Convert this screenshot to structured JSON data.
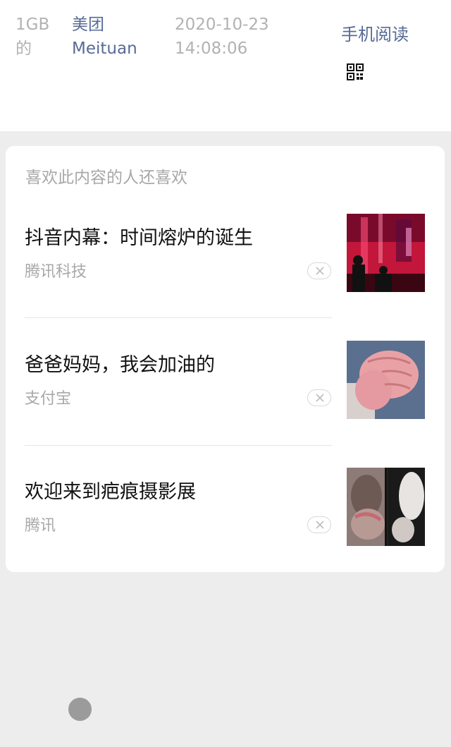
{
  "meta": {
    "size": "1GB 的",
    "source": "美团 Meituan",
    "datetime": "2020-10-23 14:08:06",
    "phone_read": "手机阅读",
    "qr_icon": "qr-code-icon"
  },
  "recommend": {
    "section_title": "喜欢此内容的人还喜欢",
    "items": [
      {
        "title": "抖音内幕：时间熔炉的诞生",
        "source": "腾讯科技",
        "thumb": "neon-bar-photo"
      },
      {
        "title": "爸爸妈妈，我会加油的",
        "source": "支付宝",
        "thumb": "fist-photo"
      },
      {
        "title": "欢迎来到疤痕摄影展",
        "source": "腾讯",
        "thumb": "scar-photo"
      }
    ],
    "dismiss_icon": "close-icon"
  },
  "colors": {
    "link": "#576b95",
    "muted": "#b2b2b2",
    "background": "#ededed"
  }
}
